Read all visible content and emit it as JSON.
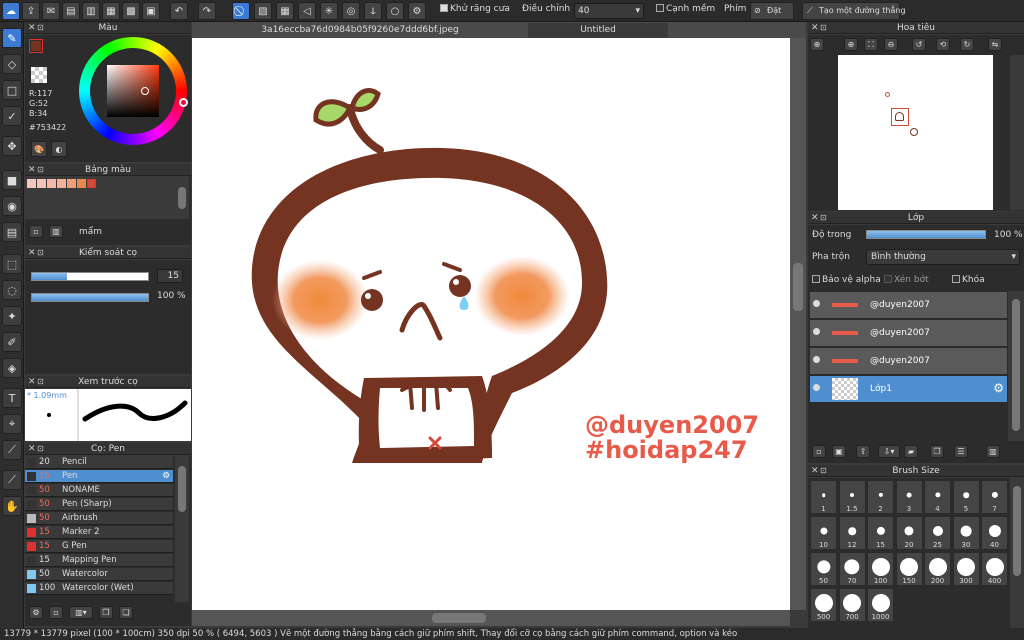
{
  "toolbar": {
    "antialias_label": "Khử răng cưa",
    "adjust_label": "Điều chỉnh",
    "adjust_value": "40",
    "smooth_label": "Cạnh mềm",
    "key_label": "Phím",
    "reset_label": "Đặt lại",
    "make_line_label": "Tạo một đường thẳng"
  },
  "document": {
    "filename": "3a16eccba76d0984b05f9260e7ddd6bf.jpeg",
    "tab2": "Untitled"
  },
  "color_panel": {
    "title": "Màu",
    "r": "R:117",
    "g": "G:52",
    "b": "B:34",
    "hex": "#753422",
    "current_color": "#753422"
  },
  "palette_panel": {
    "title": "Bảng màu",
    "swatches": [
      "#f4c6c0",
      "#f2c3b6",
      "#f2b9a8",
      "#f0b298",
      "#ee9f7a",
      "#e98a4c",
      "#d14b38"
    ],
    "palette_name": "mẩm"
  },
  "brush_control": {
    "title": "Kiểm soát cọ",
    "size_value": "15",
    "size_fraction": 0.3,
    "opacity_value": "100 %",
    "opacity_fraction": 1.0
  },
  "brush_preview": {
    "title": "Xem trước cọ",
    "size_label": "* 1.09mm"
  },
  "brush_list": {
    "title": "Cọ: Pen",
    "items": [
      {
        "size": "20",
        "name": "Pencil",
        "color": "#333333",
        "selected": false
      },
      {
        "size": "15",
        "name": "Pen",
        "color": "#333333",
        "selected": true
      },
      {
        "size": "50",
        "name": "NONAME",
        "color": "#333333",
        "selected": false
      },
      {
        "size": "50",
        "name": "Pen (Sharp)",
        "color": "#333333",
        "selected": false
      },
      {
        "size": "50",
        "name": "Airbrush",
        "color": "#bbbbbb",
        "selected": false
      },
      {
        "size": "15",
        "name": "Marker 2",
        "color": "#e03030",
        "selected": false
      },
      {
        "size": "15",
        "name": "G Pen",
        "color": "#e03030",
        "selected": false
      },
      {
        "size": "15",
        "name": "Mapping Pen",
        "color": "#333333",
        "selected": false
      },
      {
        "size": "50",
        "name": "Watercolor",
        "color": "#7fc8f0",
        "selected": false
      },
      {
        "size": "100",
        "name": "Watercolor (Wet)",
        "color": "#7fc8f0",
        "selected": false
      }
    ]
  },
  "navigator": {
    "title": "Hoa tiêu"
  },
  "layers": {
    "title": "Lớp",
    "opacity_label": "Độ trong",
    "opacity_value": "100 %",
    "opacity_fraction": 1.0,
    "blend_label": "Pha trộn",
    "blend_value": "Bình thường",
    "protect_alpha": "Bảo vệ alpha",
    "clipping": "Xén bớt",
    "lock": "Khóa",
    "items": [
      {
        "name": "@duyen2007",
        "selected": false
      },
      {
        "name": "@duyen2007",
        "selected": false
      },
      {
        "name": "@duyen2007",
        "selected": false
      },
      {
        "name": "Lớp1",
        "selected": true
      }
    ]
  },
  "brush_size": {
    "title": "Brush Size",
    "sizes": [
      "1",
      "1.5",
      "2",
      "3",
      "4",
      "5",
      "7",
      "10",
      "12",
      "15",
      "20",
      "25",
      "30",
      "40",
      "50",
      "70",
      "100",
      "150",
      "200",
      "300",
      "400",
      "500",
      "700",
      "1000"
    ]
  },
  "canvas": {
    "watermark1": "@duyen2007",
    "watermark2": "#hoidap247"
  },
  "status": {
    "text": "13779 * 13779 pixel   (100 * 100cm)   350 dpi   50 %   ( 6494, 5603 )   Vẽ một đường thẳng bằng cách giữ phím shift, Thay đổi cỡ cọ bằng cách giữ phím command, option và kéo"
  }
}
